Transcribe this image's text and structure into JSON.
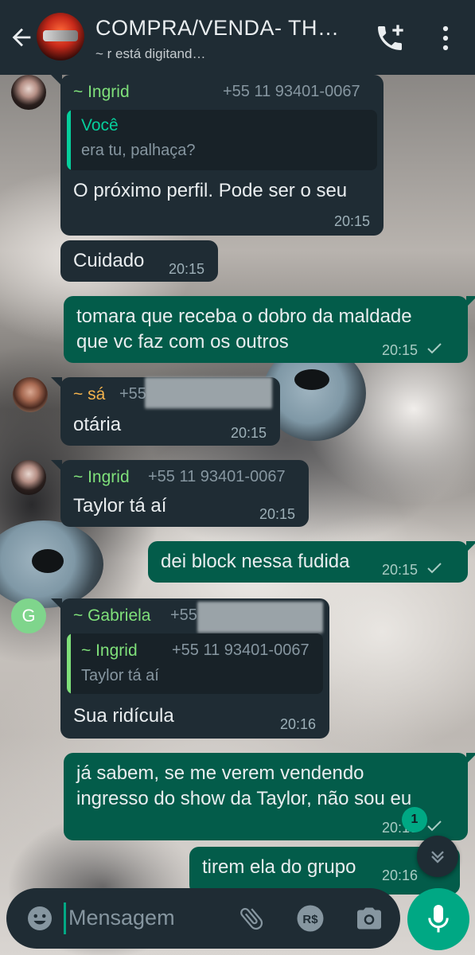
{
  "header": {
    "title": "COMPRA/VENDA- TH…",
    "subtitle": "~ r está digitand…"
  },
  "messages": [
    {
      "sender": "~ Ingrid",
      "phone": "+55 11 93401-0067",
      "quote_author": "Você",
      "quote_text": "era tu, palhaça?",
      "text": "O próximo perfil. Pode ser o seu",
      "time": "20:15"
    },
    {
      "text": "Cuidado",
      "time": "20:15"
    },
    {
      "line1": "tomara que receba o dobro da maldade",
      "line2": "que vc faz com os outros",
      "time": "20:15"
    },
    {
      "sender": "~ sá",
      "phone_prefix": "+55",
      "text": "otária",
      "time": "20:15"
    },
    {
      "sender": "~ Ingrid",
      "phone": "+55 11 93401-0067",
      "text": "Taylor tá aí",
      "time": "20:15"
    },
    {
      "text": "dei block nessa fudida",
      "time": "20:15"
    },
    {
      "avatar_letter": "G",
      "sender": "~ Gabriela",
      "phone_prefix": "+55",
      "quote_author": "~ Ingrid",
      "quote_phone": "+55 11 93401-0067",
      "quote_text": "Taylor tá aí",
      "text": "Sua ridícula",
      "time": "20:16"
    },
    {
      "line1": "já sabem, se me verem vendendo",
      "line2": "ingresso do show da Taylor, não sou eu",
      "time": "20:15"
    },
    {
      "text": "tirem ela do grupo",
      "time": "20:16"
    }
  ],
  "unread_count": "1",
  "composer": {
    "placeholder": "Mensagem"
  },
  "colors": {
    "header_bg": "#1f2c34",
    "incoming_bubble": "#1f2c34",
    "outgoing_bubble": "#035c4a",
    "accent": "#00a884",
    "sender_green": "#7fe07a",
    "sender_orange": "#f2b24d"
  },
  "icons": [
    "back-arrow-icon",
    "add-call-icon",
    "more-vert-icon",
    "check-icon",
    "emoji-icon",
    "attach-clip-icon",
    "payment-icon",
    "camera-icon",
    "mic-icon",
    "chevron-down-icon"
  ]
}
